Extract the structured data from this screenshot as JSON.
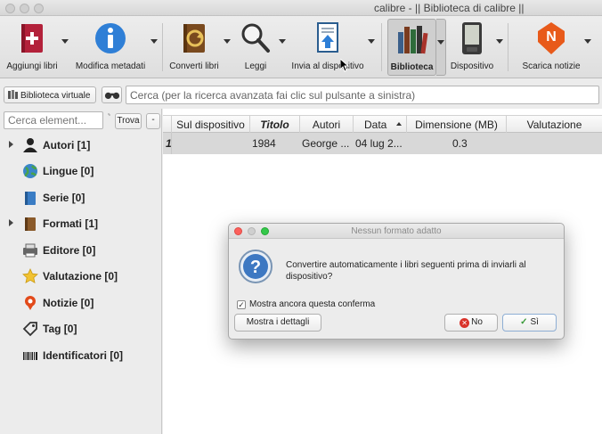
{
  "window": {
    "title": "calibre - || Biblioteca di calibre ||"
  },
  "toolbar": {
    "items": [
      {
        "label": "Aggiungi libri",
        "icon": "add-book-icon",
        "has_menu": true
      },
      {
        "label": "Modifica metadati",
        "icon": "info-icon",
        "has_menu": true
      },
      {
        "label": "Converti libri",
        "icon": "convert-book-icon",
        "has_menu": true
      },
      {
        "label": "Leggi",
        "icon": "magnifier-icon",
        "has_menu": true
      },
      {
        "label": "Invia al dispositivo",
        "icon": "send-to-device-icon",
        "has_menu": true
      },
      {
        "label": "Biblioteca",
        "icon": "library-books-icon",
        "has_menu": true,
        "active": true
      },
      {
        "label": "Dispositivo",
        "icon": "ereader-icon",
        "has_menu": true
      },
      {
        "label": "Scarica notizie",
        "icon": "news-download-icon",
        "has_menu": true
      }
    ]
  },
  "search": {
    "virtual_library_label": "Biblioteca virtuale",
    "placeholder": "Cerca (per la ricerca avanzata fai clic sul pulsante a sinistra)"
  },
  "tag_browser": {
    "find_placeholder": "Cerca element...",
    "find_button": "Trova",
    "collapse_button": "-",
    "items": [
      {
        "label": "Autori [1]",
        "icon": "person-icon",
        "expandable": true
      },
      {
        "label": "Lingue [0]",
        "icon": "globe-icon",
        "expandable": false
      },
      {
        "label": "Serie [0]",
        "icon": "series-icon",
        "expandable": false
      },
      {
        "label": "Formati [1]",
        "icon": "book-format-icon",
        "expandable": true
      },
      {
        "label": "Editore [0]",
        "icon": "publisher-icon",
        "expandable": false
      },
      {
        "label": "Valutazione [0]",
        "icon": "star-icon",
        "expandable": false
      },
      {
        "label": "Notizie [0]",
        "icon": "news-icon",
        "expandable": false
      },
      {
        "label": "Tag [0]",
        "icon": "tag-icon",
        "expandable": false
      },
      {
        "label": "Identificatori [0]",
        "icon": "barcode-icon",
        "expandable": false
      }
    ]
  },
  "table": {
    "columns": [
      "Sul dispositivo",
      "Titolo",
      "Autori",
      "Data",
      "Dimensione (MB)",
      "Valutazione"
    ],
    "sorted_column": "Data",
    "rows": [
      {
        "num": "1",
        "on_device": "",
        "title": "1984",
        "authors": "George ...",
        "date": "04 lug 2...",
        "size": "0.3",
        "rating": ""
      }
    ]
  },
  "dialog": {
    "title": "Nessun formato adatto",
    "message": "Convertire automaticamente i libri seguenti prima di inviarli al dispositivo?",
    "checkbox_label": "Mostra ancora questa conferma",
    "checkbox_checked": true,
    "details_button": "Mostra i dettagli",
    "no_button": "No",
    "yes_button": "Sì"
  }
}
